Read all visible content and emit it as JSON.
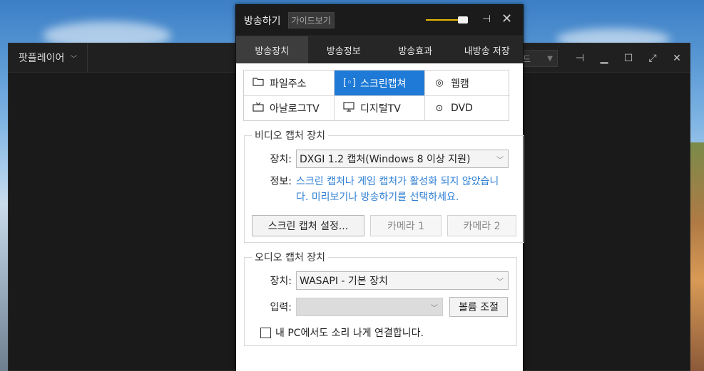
{
  "player": {
    "title": "팟플레이어",
    "mode_label": "드",
    "icons": [
      "pin-icon",
      "minimize-icon",
      "maximize-icon",
      "fullscreen-icon",
      "close-icon"
    ]
  },
  "dialog": {
    "title": "방송하기",
    "guide_label": "가이드보기",
    "volume_level": 0.8,
    "tabs": [
      {
        "label": "방송장치",
        "active": true
      },
      {
        "label": "방송정보",
        "active": false
      },
      {
        "label": "방송효과",
        "active": false
      },
      {
        "label": "내방송 저장",
        "active": false
      }
    ],
    "sources": [
      {
        "label": "파일주소",
        "icon": "folder-icon",
        "active": false
      },
      {
        "label": "스크린캡쳐",
        "icon": "screen-capture-icon",
        "active": true
      },
      {
        "label": "웹캠",
        "icon": "webcam-icon",
        "active": false
      },
      {
        "label": "아날로그TV",
        "icon": "tv-icon",
        "active": false
      },
      {
        "label": "디지털TV",
        "icon": "monitor-icon",
        "active": false
      },
      {
        "label": "DVD",
        "icon": "disc-icon",
        "active": false
      }
    ],
    "video": {
      "legend": "비디오 캡처 장치",
      "device_label": "장치:",
      "device_value": "DXGI 1.2 캡처(Windows 8 이상 지원)",
      "info_label": "정보:",
      "info_text": "스크린 캡처나 게임 캡처가 활성화 되지 않았습니다. 미리보기나 방송하기를 선택하세요.",
      "buttons": [
        {
          "label": "스크린 캡처 설정...",
          "enabled": true
        },
        {
          "label": "카메라 1",
          "enabled": false
        },
        {
          "label": "카메라 2",
          "enabled": false
        }
      ]
    },
    "audio": {
      "legend": "오디오 캡처 장치",
      "device_label": "장치:",
      "device_value": "WASAPI - 기본 장치",
      "input_label": "입력:",
      "input_value": "",
      "volume_button": "볼륨 조절",
      "checkbox_label": "내 PC에서도 소리 나게 연결합니다.",
      "checkbox_checked": false
    }
  },
  "colors": {
    "accent": "#1e7ad6",
    "info_text": "#2f7fd4",
    "volume_track": "#e8b800",
    "titlebar": "#1b1b1b",
    "tabbar": "#262626"
  }
}
